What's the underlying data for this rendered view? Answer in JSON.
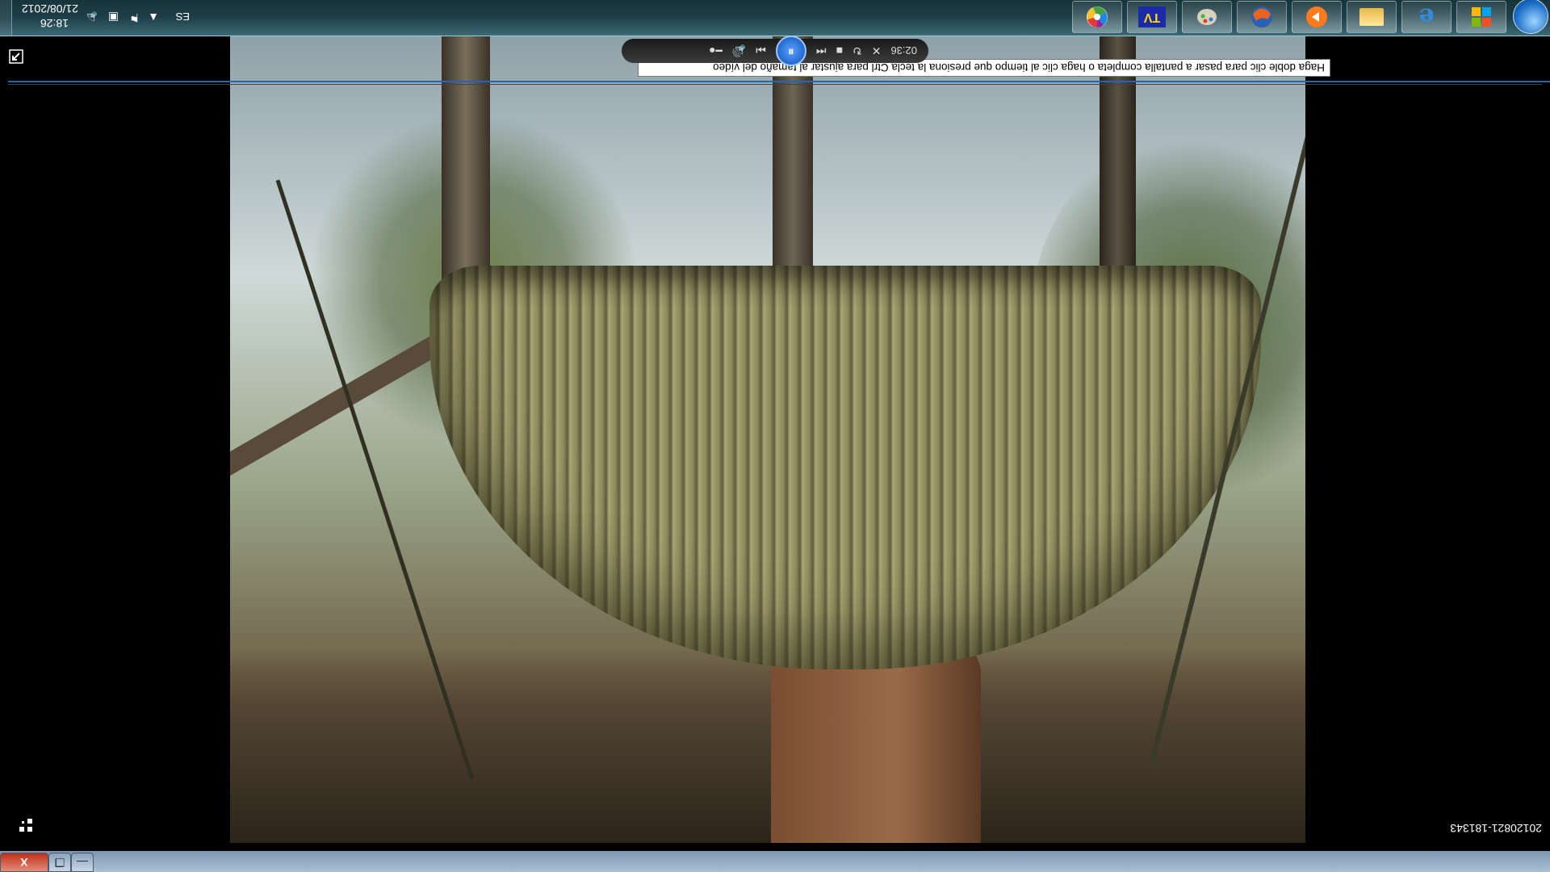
{
  "window": {
    "title": "",
    "buttons": {
      "minimize": "—",
      "maximize": "❐",
      "close": "X"
    }
  },
  "player": {
    "filename": "20120821-181343",
    "tooltip": "Haga doble clic para pasar a pantalla completa o haga clic al tiempo que presiona la tecla Ctrl para ajustar al tamaño del vídeo",
    "time": "02:36"
  },
  "taskbar": {
    "pinned": [
      "windows-explorer-icon",
      "internet-explorer-icon",
      "folder-icon",
      "media-player-icon",
      "firefox-icon",
      "paint-icon",
      "tv-icon",
      "color-wheel-icon"
    ]
  },
  "tray": {
    "language": "ES",
    "time": "18:26",
    "date": "21/08/2012"
  }
}
